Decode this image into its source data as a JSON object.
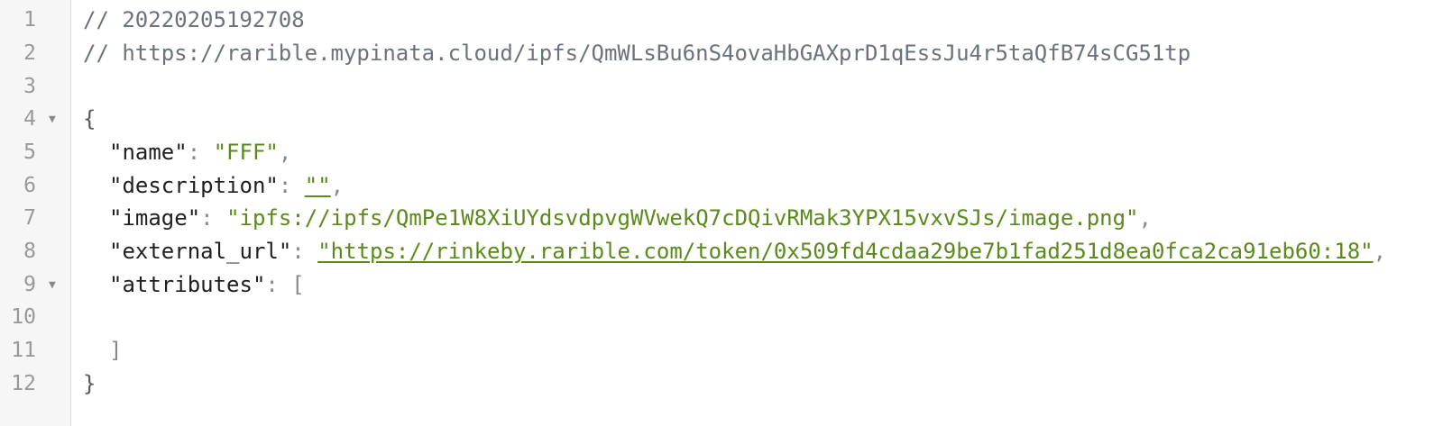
{
  "editor": {
    "line_numbers": [
      "1",
      "2",
      "3",
      "4",
      "5",
      "6",
      "7",
      "8",
      "9",
      "10",
      "11",
      "12"
    ],
    "comment_1": "// 20220205192708",
    "comment_2": "// https://rarible.mypinata.cloud/ipfs/QmWLsBu6nS4ovaHbGAXprD1qEssJu4r5taQfB74sCG51tp",
    "open_brace": "{",
    "close_brace": "}",
    "fields": {
      "name_key": "\"name\"",
      "name_value": "\"FFF\"",
      "description_key": "\"description\"",
      "description_value": "\"\"",
      "image_key": "\"image\"",
      "image_value": "\"ipfs://ipfs/QmPe1W8XiUYdsvdpvgWVwekQ7cDQivRMak3YPX15vxvSJs/image.png\"",
      "external_url_key": "\"external_url\"",
      "external_url_value": "\"https://rinkeby.rarible.com/token/0x509fd4cdaa29be7b1fad251d8ea0fca2ca91eb60:18\"",
      "attributes_key": "\"attributes\"",
      "attributes_open": "[",
      "attributes_close": "]"
    },
    "colon": ": ",
    "comma": ","
  }
}
